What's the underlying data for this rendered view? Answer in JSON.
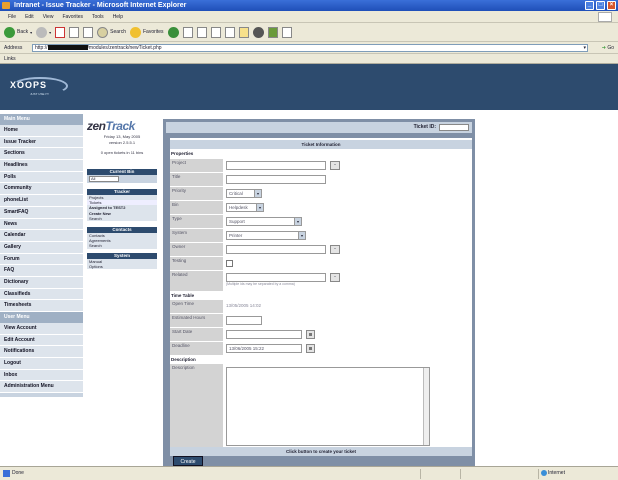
{
  "window": {
    "title": "Intranet - Issue Tracker - Microsoft Internet Explorer"
  },
  "menu": [
    "File",
    "Edit",
    "View",
    "Favorites",
    "Tools",
    "Help"
  ],
  "toolbar": {
    "back": "Back",
    "search": "Search",
    "favorites": "Favorites"
  },
  "address": {
    "label": "Address",
    "url_suffix": "/modules/zentrack/newTicket.php",
    "go": "Go",
    "links": "Links"
  },
  "banner": {
    "logo": "XOOPS",
    "tagline": "JUST USE IT!"
  },
  "sidebar": {
    "main_menu": "Main Menu",
    "items": [
      "Home",
      "Issue Tracker",
      "Sections",
      "Headlines",
      "Polls",
      "Community",
      "phoneList",
      "SmartFAQ",
      "News",
      "Calendar",
      "Gallery",
      "Forum",
      "FAQ",
      "Dictionary",
      "Classifieds",
      "Timesheets"
    ],
    "user_menu": "User Menu",
    "user_items": [
      "View Account",
      "Edit Account",
      "Notifications",
      "Logout",
      "Inbox",
      "Administration Menu"
    ]
  },
  "zentrack": {
    "logo_a": "zen",
    "logo_b": "Track",
    "date": "Friday 13, May 2005",
    "version": "version 2.5.5.1",
    "open": "0 open tickets in 11 bins",
    "current_bin": "Current Bin",
    "bin_value": "All",
    "tracker": "Tracker",
    "tracker_items": [
      "Projects",
      "Tickets",
      "Assigned to TEST2",
      "Create New",
      "Search"
    ],
    "contacts": "Contacts",
    "contact_items": [
      "Contacts",
      "Agreements",
      "Search"
    ],
    "system": "System",
    "system_items": [
      "Manual",
      "Options"
    ]
  },
  "form": {
    "ticket_id_label": "Ticket ID:",
    "ticket_information": "Ticket Information",
    "properties": "Properties",
    "fields": {
      "project": "Project",
      "title": "Title",
      "priority": "Priority",
      "priority_value": "Critical",
      "bin": "Bin",
      "bin_value": "Helpdesk",
      "type": "Type",
      "type_value": "Support",
      "system": "System",
      "system_value": "Printer",
      "owner": "Owner",
      "testing": "Testing",
      "related": "Related",
      "related_hint": "(Multiple ids may be separated by a comma)"
    },
    "time_table": "Time Table",
    "time_fields": {
      "open_time": "Open Time",
      "open_time_value": "13/05/2005 14:02",
      "estimated_hours": "Estimated Hours",
      "start_date": "Start Date",
      "deadline": "Deadline",
      "deadline_value": "13/06/2005 15:22"
    },
    "description": "Description",
    "description_label": "Description",
    "click_text": "Click button to create your ticket",
    "create_button": "Create"
  },
  "status": {
    "done": "Done",
    "zone": "Internet"
  }
}
